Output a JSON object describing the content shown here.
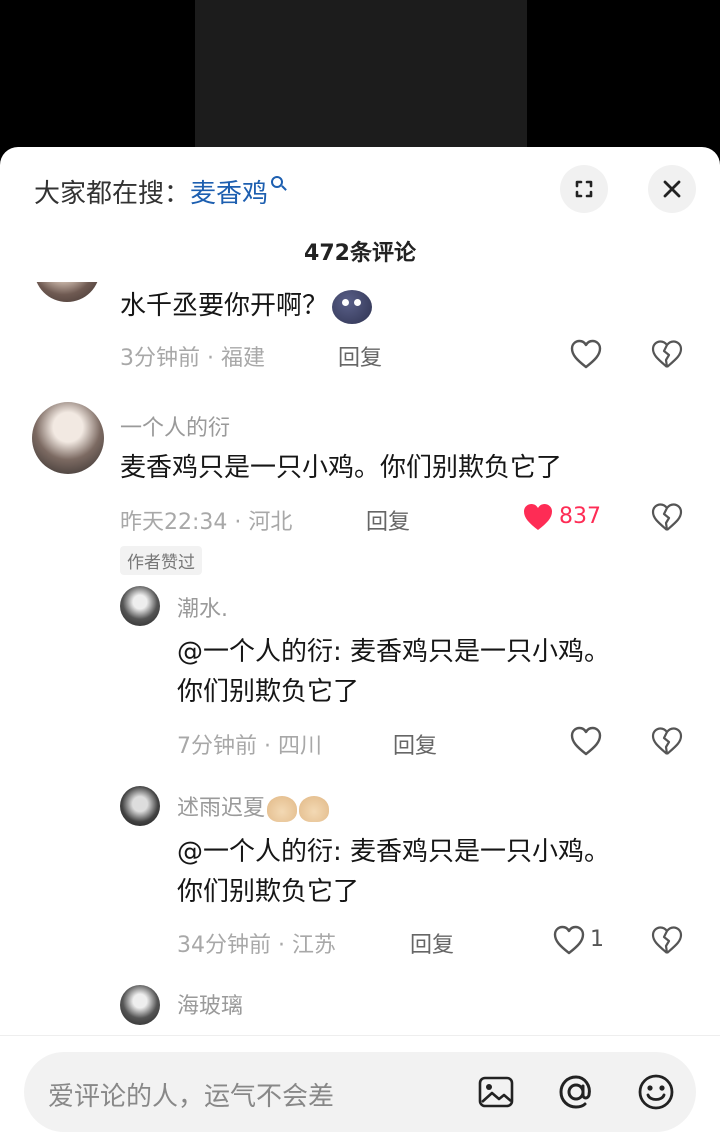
{
  "search": {
    "prefix": "大家都在搜：",
    "keyword": "麦香鸡"
  },
  "comment_count": "472条评论",
  "comments": [
    {
      "name": "",
      "text": "水千丞要你开啊？",
      "time": "3分钟前",
      "location": "福建",
      "reply": "回复",
      "likes": ""
    },
    {
      "name": "一个人的衍",
      "text": "麦香鸡只是一只小鸡。你们别欺负它了",
      "time": "昨天22:34",
      "location": "河北",
      "reply": "回复",
      "likes": "837",
      "badge": "作者赞过"
    }
  ],
  "replies": [
    {
      "name": "潮水.",
      "line1": "@一个人的衍: 麦香鸡只是一只小鸡。",
      "line2": "你们别欺负它了",
      "time": "7分钟前",
      "location": "四川",
      "reply": "回复",
      "likes": ""
    },
    {
      "name": "述雨迟夏",
      "line1": "@一个人的衍: 麦香鸡只是一只小鸡。",
      "line2": "你们别欺负它了",
      "time": "34分钟前",
      "location": "江苏",
      "reply": "回复",
      "likes": "1"
    },
    {
      "name": "海玻璃"
    }
  ],
  "input": {
    "placeholder": "爱评论的人，运气不会差"
  },
  "icons": [
    "expand-icon",
    "close-icon",
    "search-icon",
    "heart-icon",
    "heart-filled-icon",
    "broken-heart-icon",
    "image-icon",
    "at-icon",
    "emoji-icon"
  ],
  "colors": {
    "keyword": "#1d5fb0",
    "liked": "#fe2c55"
  }
}
